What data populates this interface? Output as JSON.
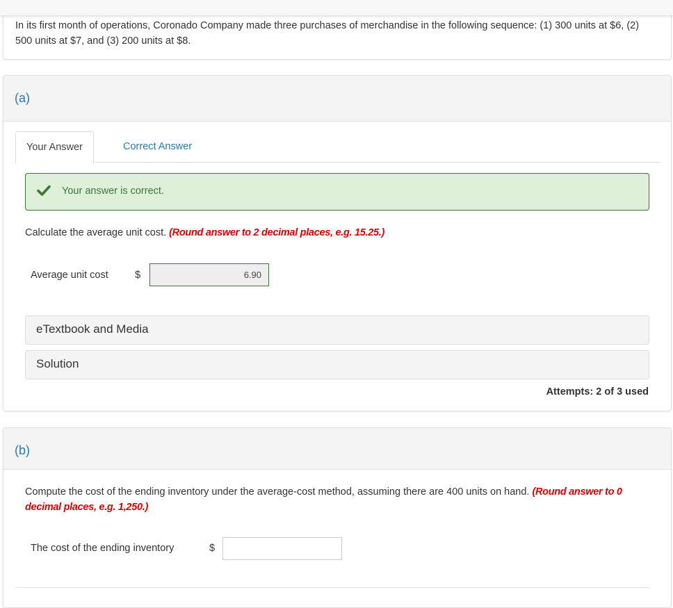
{
  "question": {
    "text": "In its first month of operations, Coronado Company made three purchases of merchandise in the following sequence: (1) 300 units at $6, (2) 500 units at $7, and (3) 200 units at $8."
  },
  "part_a": {
    "label": "(a)",
    "tabs": [
      {
        "label": "Your Answer",
        "active": true
      },
      {
        "label": "Correct Answer",
        "active": false
      }
    ],
    "feedback": {
      "icon": "check-icon",
      "message": "Your answer is correct.",
      "color": "#3c763d",
      "background": "#dff0d8"
    },
    "instruction": "Calculate the average unit cost.",
    "hint": "(Round answer to 2 decimal places, e.g. 15.25.)",
    "field": {
      "label": "Average unit cost",
      "currency": "$",
      "value": "6.90"
    },
    "accordions": [
      {
        "label": "eTextbook and Media"
      },
      {
        "label": "Solution"
      }
    ],
    "attempts": "Attempts: 2 of 3 used"
  },
  "part_b": {
    "label": "(b)",
    "instruction": "Compute the cost of the ending inventory under the average-cost method, assuming there are 400 units on hand.",
    "hint": "(Round answer to 0 decimal places, e.g. 1,250.)",
    "field": {
      "label": "The cost of the ending inventory",
      "currency": "$",
      "value": ""
    }
  },
  "colors": {
    "part_label": "#2a7ab0",
    "hint": "#e00000",
    "success": "#3c763d"
  }
}
